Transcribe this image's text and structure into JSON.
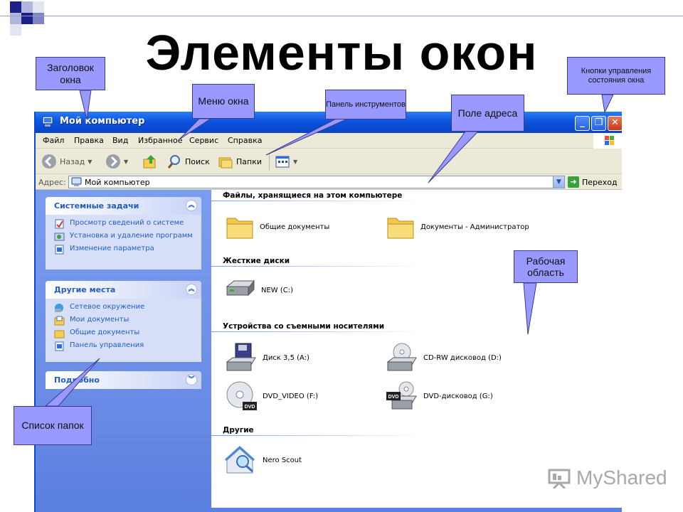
{
  "slide": {
    "title": "Элементы окон"
  },
  "window": {
    "title": "Мой компьютер",
    "controls": {
      "minimize": "_",
      "restore": "❐",
      "close": "✕"
    },
    "menu": [
      "Файл",
      "Правка",
      "Вид",
      "Избранное",
      "Сервис",
      "Справка"
    ],
    "toolbar": {
      "back": "Назад",
      "search": "Поиск",
      "folders": "Папки"
    },
    "address": {
      "label": "Адрес:",
      "value": "Мой компьютер",
      "go": "Переход"
    }
  },
  "sidebar": {
    "system_tasks": {
      "title": "Системные задачи",
      "items": [
        "Просмотр сведений о системе",
        "Установка и удаление программ",
        "Изменение параметра"
      ]
    },
    "other_places": {
      "title": "Другие места",
      "items": [
        "Сетевое окружение",
        "Мои документы",
        "Общие документы",
        "Панель управления"
      ]
    },
    "details": {
      "title": "Подробно"
    }
  },
  "content": {
    "groups": [
      {
        "title": "Файлы, хранящиеся на этом компьютере",
        "items": [
          "Общие документы",
          "Документы - Администратор"
        ]
      },
      {
        "title": "Жесткие диски",
        "items": [
          "NEW (C:)"
        ]
      },
      {
        "title": "Устройства со съемными носителями",
        "items": [
          "Диск 3,5 (A:)",
          "CD-RW дисковод (D:)",
          "DVD_VIDEO (F:)",
          "DVD-дисковод (G:)"
        ]
      },
      {
        "title": "Другие",
        "items": [
          "Nero Scout"
        ]
      }
    ],
    "dvd_badge": "DVD"
  },
  "callouts": {
    "title_bar": "Заголовок окна",
    "menu": "Меню окна",
    "toolbar": "Панель инструментов",
    "address": "Поле адреса",
    "window_controls": "Кнопки управления состояния окна",
    "workspace": "Рабочая область",
    "folder_list": "Список папок"
  },
  "watermark": "MyShared",
  "colors": {
    "callout_fill": "#9999ff",
    "xp_blue": "#0c55e0",
    "sidebar_blue": "#6b8de6",
    "link_blue": "#215dc6"
  }
}
